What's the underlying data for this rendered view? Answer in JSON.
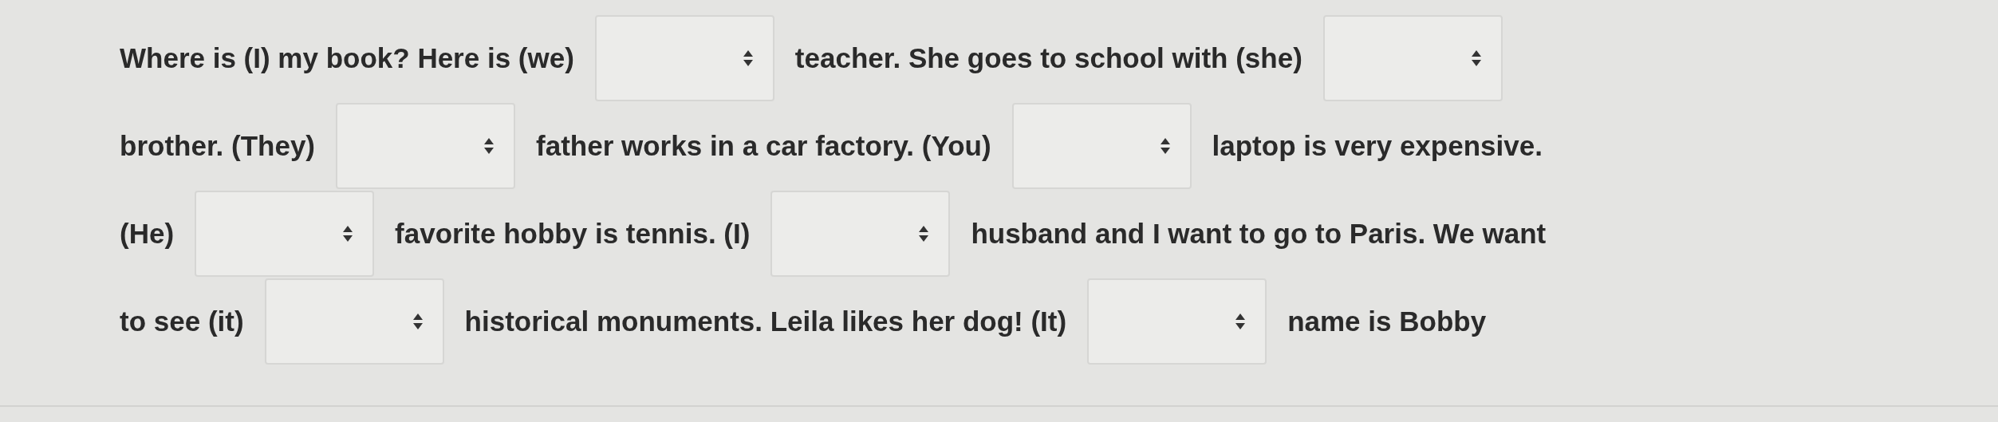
{
  "lines": [
    [
      {
        "kind": "text",
        "text": "Where is (I) my book? Here is (we)"
      },
      {
        "kind": "select"
      },
      {
        "kind": "text",
        "text": "teacher. She goes to school with (she)"
      },
      {
        "kind": "select"
      }
    ],
    [
      {
        "kind": "text",
        "text": "brother. (They)"
      },
      {
        "kind": "select"
      },
      {
        "kind": "text",
        "text": "father works in a car factory. (You)"
      },
      {
        "kind": "select"
      },
      {
        "kind": "text",
        "text": "laptop is very expensive."
      }
    ],
    [
      {
        "kind": "text",
        "text": "(He)"
      },
      {
        "kind": "select"
      },
      {
        "kind": "text",
        "text": "favorite hobby is tennis. (I)"
      },
      {
        "kind": "select"
      },
      {
        "kind": "text",
        "text": "husband and I want to go to Paris. We want"
      }
    ],
    [
      {
        "kind": "text",
        "text": "to see (it)"
      },
      {
        "kind": "select"
      },
      {
        "kind": "text",
        "text": "historical monuments. Leila likes her dog! (It)"
      },
      {
        "kind": "select"
      },
      {
        "kind": "text",
        "text": "name is Bobby"
      }
    ]
  ]
}
